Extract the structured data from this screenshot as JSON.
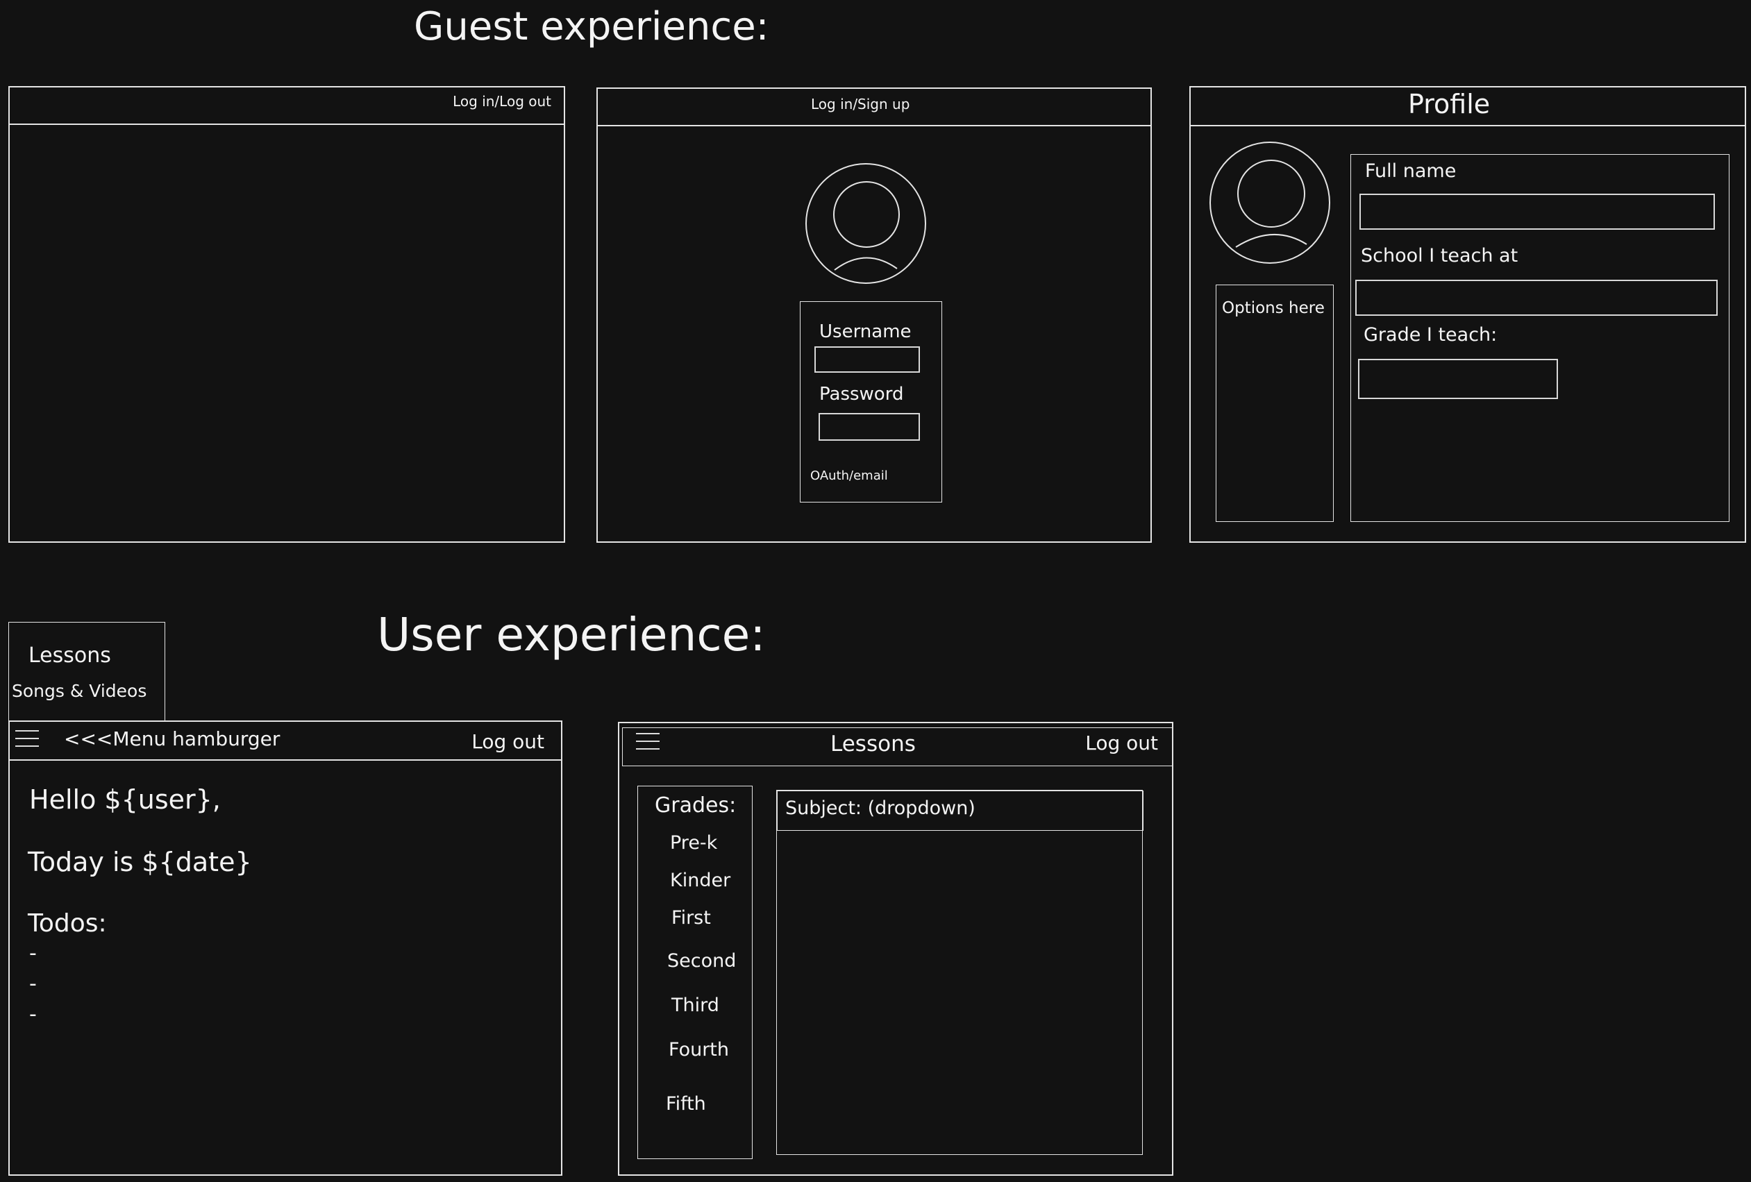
{
  "sections": {
    "guest_title": "Guest experience:",
    "user_title": "User experience:"
  },
  "guest": {
    "home": {
      "auth_link": "Log in/Log out"
    },
    "login": {
      "header": "Log in/Sign up",
      "username_label": "Username",
      "password_label": "Password",
      "oauth_label": "OAuth/email"
    },
    "profile": {
      "header": "Profile",
      "options_label": "Options here",
      "full_name_label": "Full name",
      "school_label": "School I teach at",
      "grade_label": "Grade I teach:"
    }
  },
  "user": {
    "menu_popup": {
      "items": [
        "Lessons",
        "Songs & Videos"
      ]
    },
    "dashboard": {
      "menu_label": "<<<Menu hamburger",
      "logout": "Log out",
      "greeting": "Hello ${user},",
      "today": "Today is ${date}",
      "todos_title": "Todos:",
      "todos": [
        "-",
        "-",
        "-"
      ]
    },
    "lessons": {
      "title": "Lessons",
      "logout": "Log out",
      "grades_title": "Grades:",
      "grades": [
        "Pre-k",
        "Kinder",
        "First",
        "Second",
        "Third",
        "Fourth",
        "Fifth"
      ],
      "subject_label": "Subject: (dropdown)"
    }
  },
  "colors": {
    "background": "#121212",
    "stroke": "#e4e4e4",
    "text": "#f4f4f4"
  }
}
